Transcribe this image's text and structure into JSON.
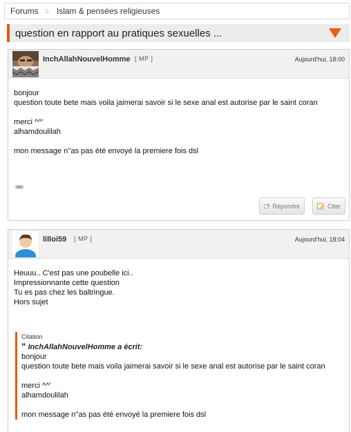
{
  "breadcrumb": {
    "items": [
      "Forums",
      "Islam & pensées religieuses"
    ]
  },
  "topic": {
    "title": "question en rapport au pratiques sexuelles ..."
  },
  "posts": [
    {
      "author": "InchAllahNouvelHomme",
      "mp_label": "[ MP ]",
      "date": "Aujourd'hui, 18:00",
      "body": "bonjour\nquestion toute bete mais voila jaimerai savoir si le sexe anal est autorise par le saint coran\n\nmerci ^^'\nalhamdoulilah\n\nmon message n''as pas été envoyé la premiere fois dsl",
      "reply_label": "Répondre",
      "cite_label": "Citer"
    },
    {
      "author": "lilloi59",
      "mp_label": "[ MP ]",
      "date": "Aujourd'hui, 18:04",
      "body": "Heuuu.. C'est pas une poubelle ici..\nImpressionnante cette question\nTu es pas chez les baltringue.\nHors sujet",
      "quote": {
        "label": "Citation",
        "author_line": "InchAllahNouvelHomme a écrit:",
        "text": "bonjour\nquestion toute bete mais voila jaimerai savoir si le sexe anal est autorise par le saint coran\n\nmerci ^^'\nalhamdoulilah\n\nmon message n''as pas été envoyé la premiere fois dsl"
      }
    }
  ],
  "colors": {
    "accent": "#e8590c",
    "header_bg": "#f1f1f1"
  }
}
